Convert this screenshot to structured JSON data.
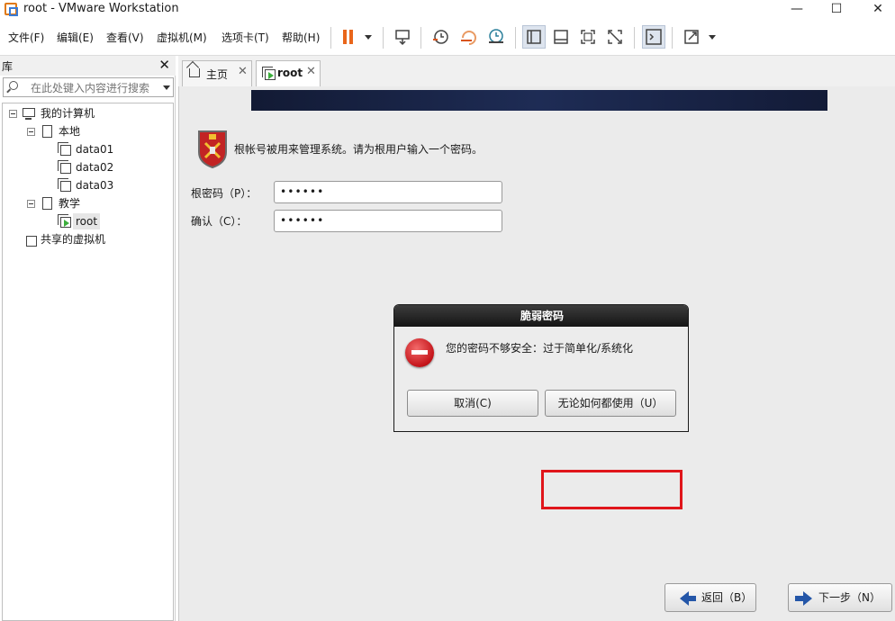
{
  "window": {
    "title": "root - VMware Workstation"
  },
  "menu": [
    "文件(F)",
    "编辑(E)",
    "查看(V)",
    "虚拟机(M)",
    "选项卡(T)",
    "帮助(H)"
  ],
  "library": {
    "title": "库",
    "search_placeholder": "在此处键入内容进行搜索",
    "tree": {
      "my_computer": "我的计算机",
      "local": "本地",
      "vms_local": [
        "data01",
        "data02",
        "data03"
      ],
      "teaching": "教学",
      "vm_teaching": "root",
      "shared": "共享的虚拟机"
    }
  },
  "tabs": [
    {
      "label": "主页"
    },
    {
      "label": "root"
    }
  ],
  "installer": {
    "message": "根帐号被用来管理系统。请为根用户输入一个密码。",
    "root_password_label": "根密码（P）：",
    "root_password_value": "••••••",
    "confirm_label": "确认（C）：",
    "confirm_value": "••••••",
    "back_button": "返回（B）",
    "next_button": "下一步（N）"
  },
  "dialog": {
    "title": "脆弱密码",
    "message": "您的密码不够安全：过于简单化/系统化",
    "cancel_button": "取消(C)",
    "use_anyway_button": "无论如何都使用（U）"
  },
  "colors": {
    "highlight": "#e0151b",
    "pause": "#e9661b"
  }
}
